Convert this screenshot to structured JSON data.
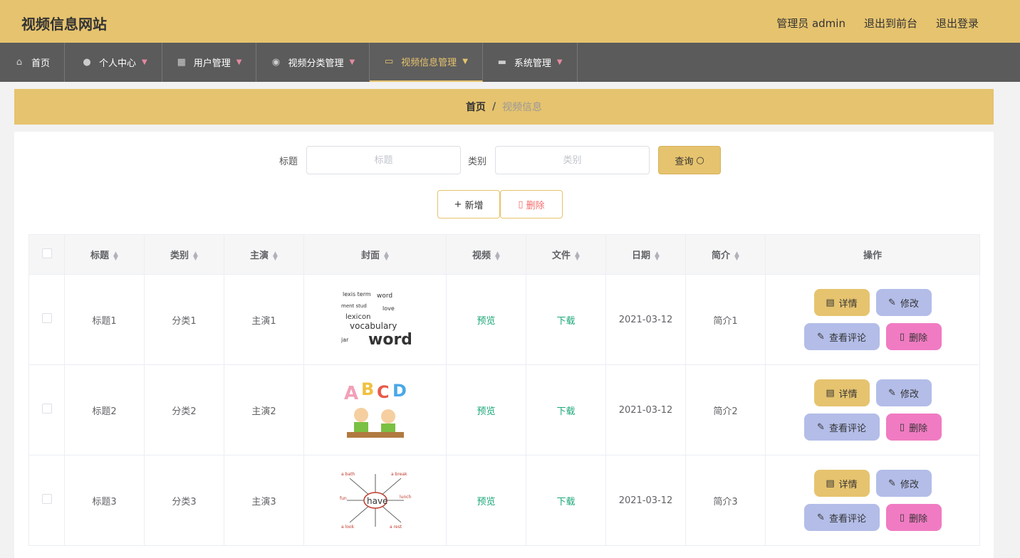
{
  "header": {
    "site_title": "视频信息网站",
    "role_user": "管理员 admin",
    "goto_frontend": "退出到前台",
    "logout": "退出登录"
  },
  "nav": [
    {
      "label": "首页",
      "icon": "home-icon",
      "active": false
    },
    {
      "label": "个人中心",
      "icon": "user-icon",
      "active": false
    },
    {
      "label": "用户管理",
      "icon": "grid-icon",
      "active": false
    },
    {
      "label": "视频分类管理",
      "icon": "bulb-icon",
      "active": false
    },
    {
      "label": "视频信息管理",
      "icon": "chat-icon",
      "active": true
    },
    {
      "label": "系统管理",
      "icon": "briefcase-icon",
      "active": false
    }
  ],
  "breadcrumb": {
    "home": "首页",
    "separator": "/",
    "current": "视频信息"
  },
  "search": {
    "title_label": "标题",
    "title_placeholder": "标题",
    "category_label": "类别",
    "category_placeholder": "类别",
    "query_button": "查询"
  },
  "actions": {
    "add": "新增",
    "delete": "删除"
  },
  "table": {
    "headers": [
      "标题",
      "类别",
      "主演",
      "封面",
      "视频",
      "文件",
      "日期",
      "简介",
      "操作"
    ],
    "rows": [
      {
        "title": "标题1",
        "category": "分类1",
        "actor": "主演1",
        "cover": "vocabulary words",
        "video": "预览",
        "file": "下载",
        "date": "2021-03-12",
        "intro": "简介1"
      },
      {
        "title": "标题2",
        "category": "分类2",
        "actor": "主演2",
        "cover": "ABCD kids",
        "video": "预览",
        "file": "下载",
        "date": "2021-03-12",
        "intro": "简介2"
      },
      {
        "title": "标题3",
        "category": "分类3",
        "actor": "主演3",
        "cover": "have",
        "video": "预览",
        "file": "下载",
        "date": "2021-03-12",
        "intro": "简介3"
      }
    ],
    "ops": {
      "detail": "详情",
      "edit": "修改",
      "comment": "查看评论",
      "delete": "删除"
    }
  },
  "colors": {
    "accent": "#e6c36e",
    "nav_bg": "#5b5b5b",
    "link": "#1aa875",
    "op_blue": "#b3bde8",
    "op_pink": "#f07bc2"
  }
}
